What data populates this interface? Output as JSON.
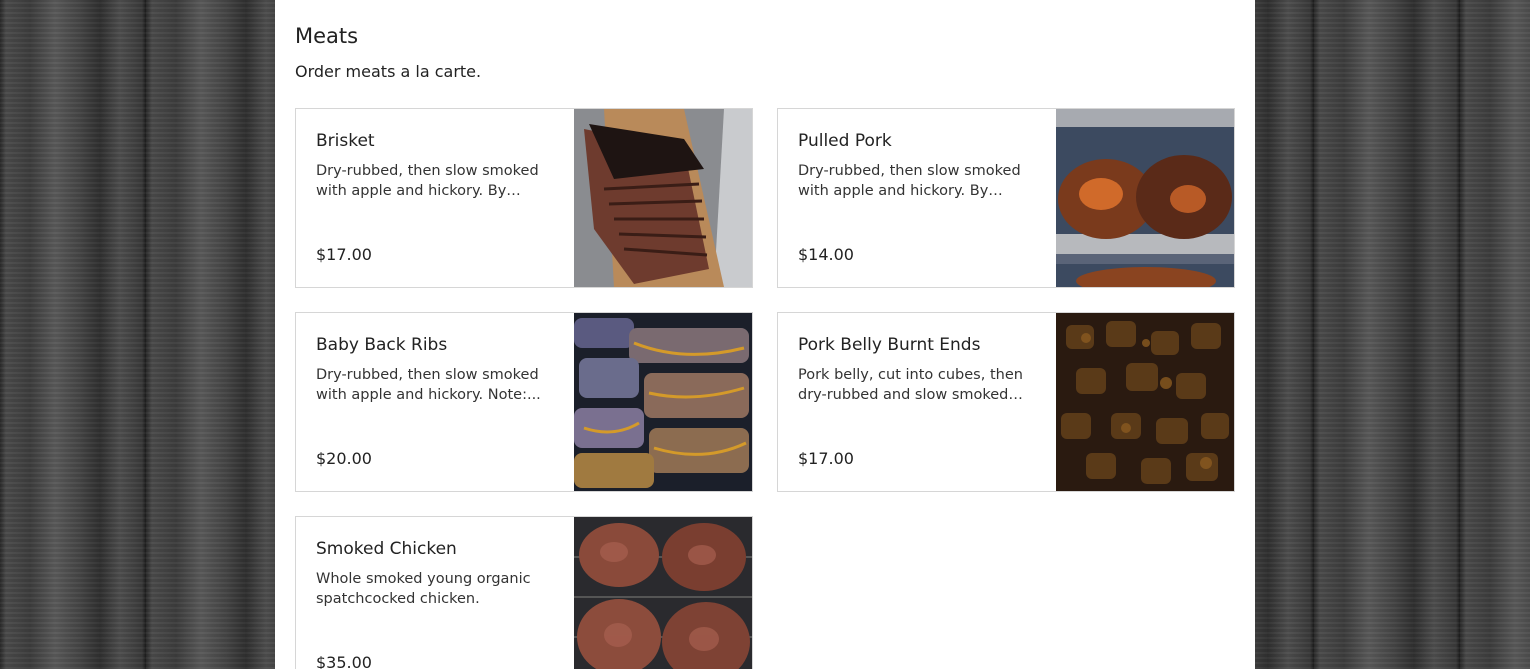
{
  "section": {
    "title": "Meats",
    "subtitle": "Order meats a la carte."
  },
  "items": [
    {
      "name": "Brisket",
      "description": "Dry-rubbed, then slow smoked with apple and hickory. By the...",
      "price": "$17.00",
      "image": "brisket-photo"
    },
    {
      "name": "Pulled Pork",
      "description": "Dry-rubbed, then slow smoked with apple and hickory. By the...",
      "price": "$14.00",
      "image": "pulled-pork-photo"
    },
    {
      "name": "Baby Back Ribs",
      "description": "Dry-rubbed, then slow smoked with apple and hickory. Note:...",
      "price": "$20.00",
      "image": "ribs-photo"
    },
    {
      "name": "Pork Belly Burnt Ends",
      "description": "Pork belly, cut into cubes, then dry-rubbed and slow smoked fo...",
      "price": "$17.00",
      "image": "burnt-ends-photo"
    },
    {
      "name": "Smoked Chicken",
      "description": "Whole smoked young organic spatchcocked chicken.",
      "price": "$35.00",
      "image": "chicken-photo"
    }
  ]
}
